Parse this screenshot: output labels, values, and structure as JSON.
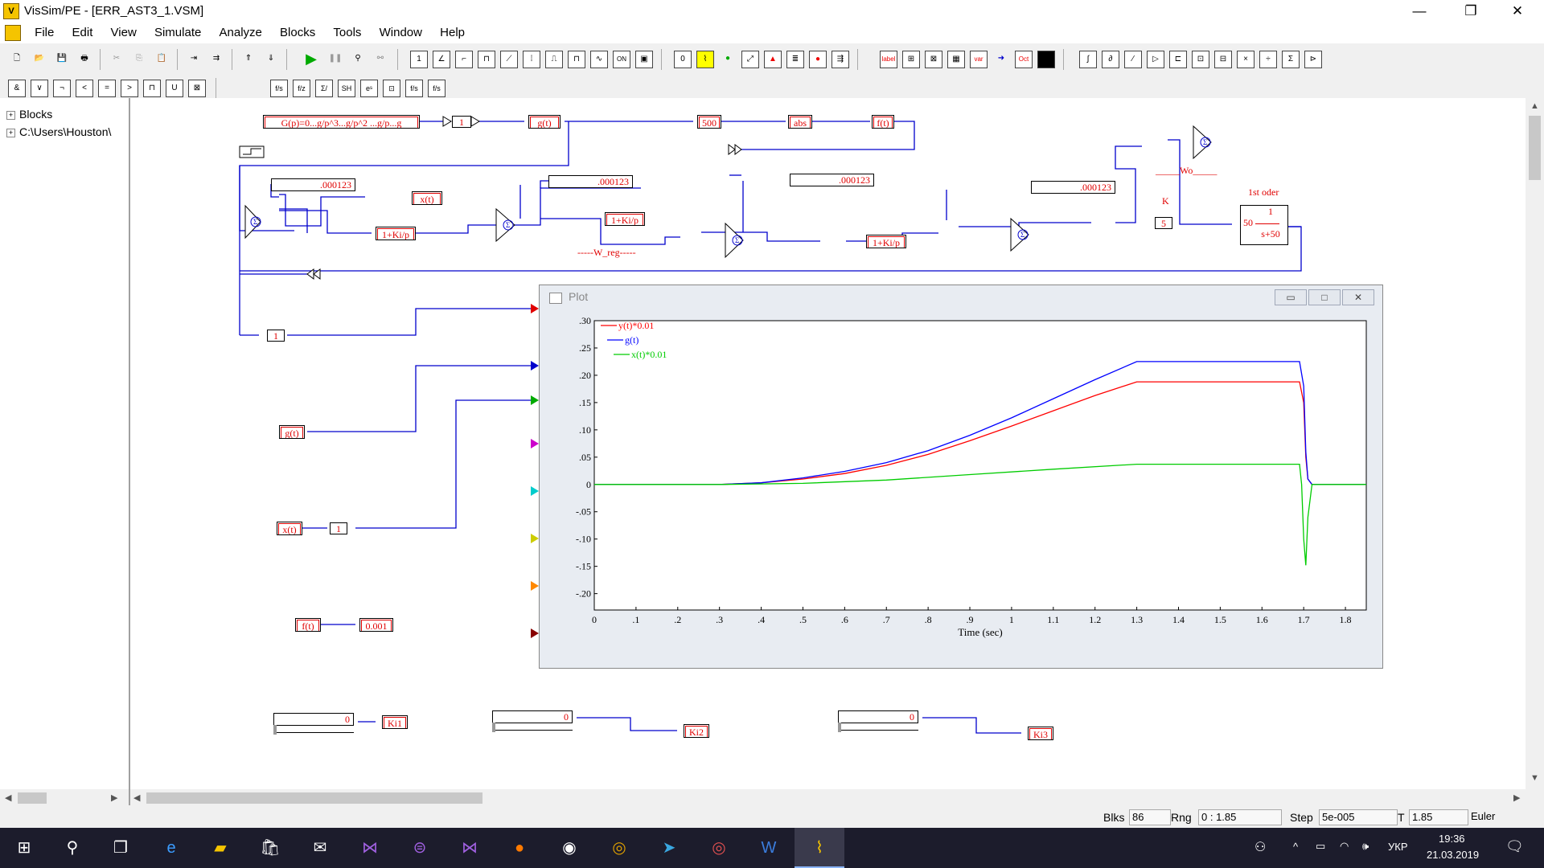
{
  "window": {
    "title": "VisSim/PE - [ERR_AST3_1.VSM]",
    "min": "—",
    "max": "❐",
    "close": "✕"
  },
  "menu": [
    "File",
    "Edit",
    "View",
    "Simulate",
    "Analyze",
    "Blocks",
    "Tools",
    "Window",
    "Help"
  ],
  "mdi": {
    "min": "–",
    "restore": "▫",
    "close": "✕"
  },
  "tree": {
    "item1": "Blocks",
    "item2": "C:\\Users\\Houston\\"
  },
  "blocks": {
    "transfer_fn": "G(p)=0...g/p^3...g/p^2 ...g/p...g",
    "one_a": "1",
    "g_out": "g(t)",
    "const500": "500",
    "abs": "abs",
    "f_out": "f(t)",
    "c1": ".000123",
    "c2": ".000123",
    "c3": ".000123",
    "c4": ".000123",
    "x_out": "x(t)",
    "reg1": "1+Ki/p",
    "reg2": "1+Ki/p",
    "reg3": "1+Ki/p",
    "w_reg": "-----W_reg-----",
    "wo": "_____Wo_____",
    "k_label": "K",
    "k_val": "5",
    "first_order_label": "1st oder",
    "tf_num": "1",
    "tf_gain": "50",
    "tf_den": "s+50",
    "one_b": "1",
    "g_in": "g(t)",
    "x_in": "x(t)",
    "one_c": "1",
    "f_in": "f(t)",
    "c_001": "0.001",
    "slider1_val": "0",
    "slider2_val": "0",
    "slider3_val": "0",
    "ki1": "Ki1",
    "ki2": "Ki2",
    "ki3": "Ki3"
  },
  "plot": {
    "title": "Plot",
    "btn_min": "▭",
    "btn_max": "□",
    "btn_close": "✕"
  },
  "chart_data": {
    "type": "line",
    "title": "",
    "xlabel": "Time (sec)",
    "ylabel": "",
    "xlim": [
      0,
      1.85
    ],
    "ylim": [
      -0.23,
      0.3
    ],
    "xticks": [
      "0",
      ".1",
      ".2",
      ".3",
      ".4",
      ".5",
      ".6",
      ".7",
      ".8",
      ".9",
      "1",
      "1.1",
      "1.2",
      "1.3",
      "1.4",
      "1.5",
      "1.6",
      "1.7",
      "1.8"
    ],
    "yticks": [
      ".30",
      ".25",
      ".20",
      ".15",
      ".10",
      ".05",
      "0",
      "-.05",
      "-.10",
      "-.15",
      "-.20"
    ],
    "legend_position": "top-left",
    "series": [
      {
        "name": "y(t)*0.01",
        "color": "#ff0000",
        "x": [
          0,
          0.3,
          0.4,
          0.5,
          0.6,
          0.7,
          0.8,
          0.9,
          1.0,
          1.1,
          1.2,
          1.3,
          1.69,
          1.7,
          1.705,
          1.71,
          1.72,
          1.85
        ],
        "y": [
          0,
          0,
          0.003,
          0.01,
          0.02,
          0.035,
          0.055,
          0.08,
          0.107,
          0.135,
          0.163,
          0.188,
          0.188,
          0.15,
          0.05,
          0.01,
          0,
          0
        ]
      },
      {
        "name": "g(t)",
        "color": "#0000ff",
        "x": [
          0,
          0.3,
          0.4,
          0.5,
          0.6,
          0.7,
          0.8,
          0.9,
          1.0,
          1.1,
          1.2,
          1.3,
          1.69,
          1.7,
          1.705,
          1.71,
          1.72,
          1.85
        ],
        "y": [
          0,
          0,
          0.003,
          0.012,
          0.024,
          0.04,
          0.062,
          0.09,
          0.122,
          0.157,
          0.192,
          0.225,
          0.225,
          0.18,
          0.06,
          0.01,
          0,
          0
        ]
      },
      {
        "name": "x(t)*0.01",
        "color": "#00cc00",
        "x": [
          0,
          0.3,
          0.5,
          0.7,
          0.9,
          1.1,
          1.3,
          1.69,
          1.695,
          1.7,
          1.705,
          1.71,
          1.72,
          1.85
        ],
        "y": [
          0,
          0,
          0.002,
          0.008,
          0.018,
          0.028,
          0.037,
          0.037,
          0.0,
          -0.1,
          -0.148,
          -0.06,
          0,
          0
        ]
      }
    ]
  },
  "status": {
    "blks_label": "Blks",
    "blks": "86",
    "rng_label": "Rng",
    "rng": "0 : 1.85",
    "step_label": "Step",
    "step": "5e-005",
    "t_label": "T",
    "t": "1.85",
    "method": "Euler"
  },
  "taskbar": {
    "lang": "УКР",
    "time": "19:36",
    "date": "21.03.2019"
  }
}
